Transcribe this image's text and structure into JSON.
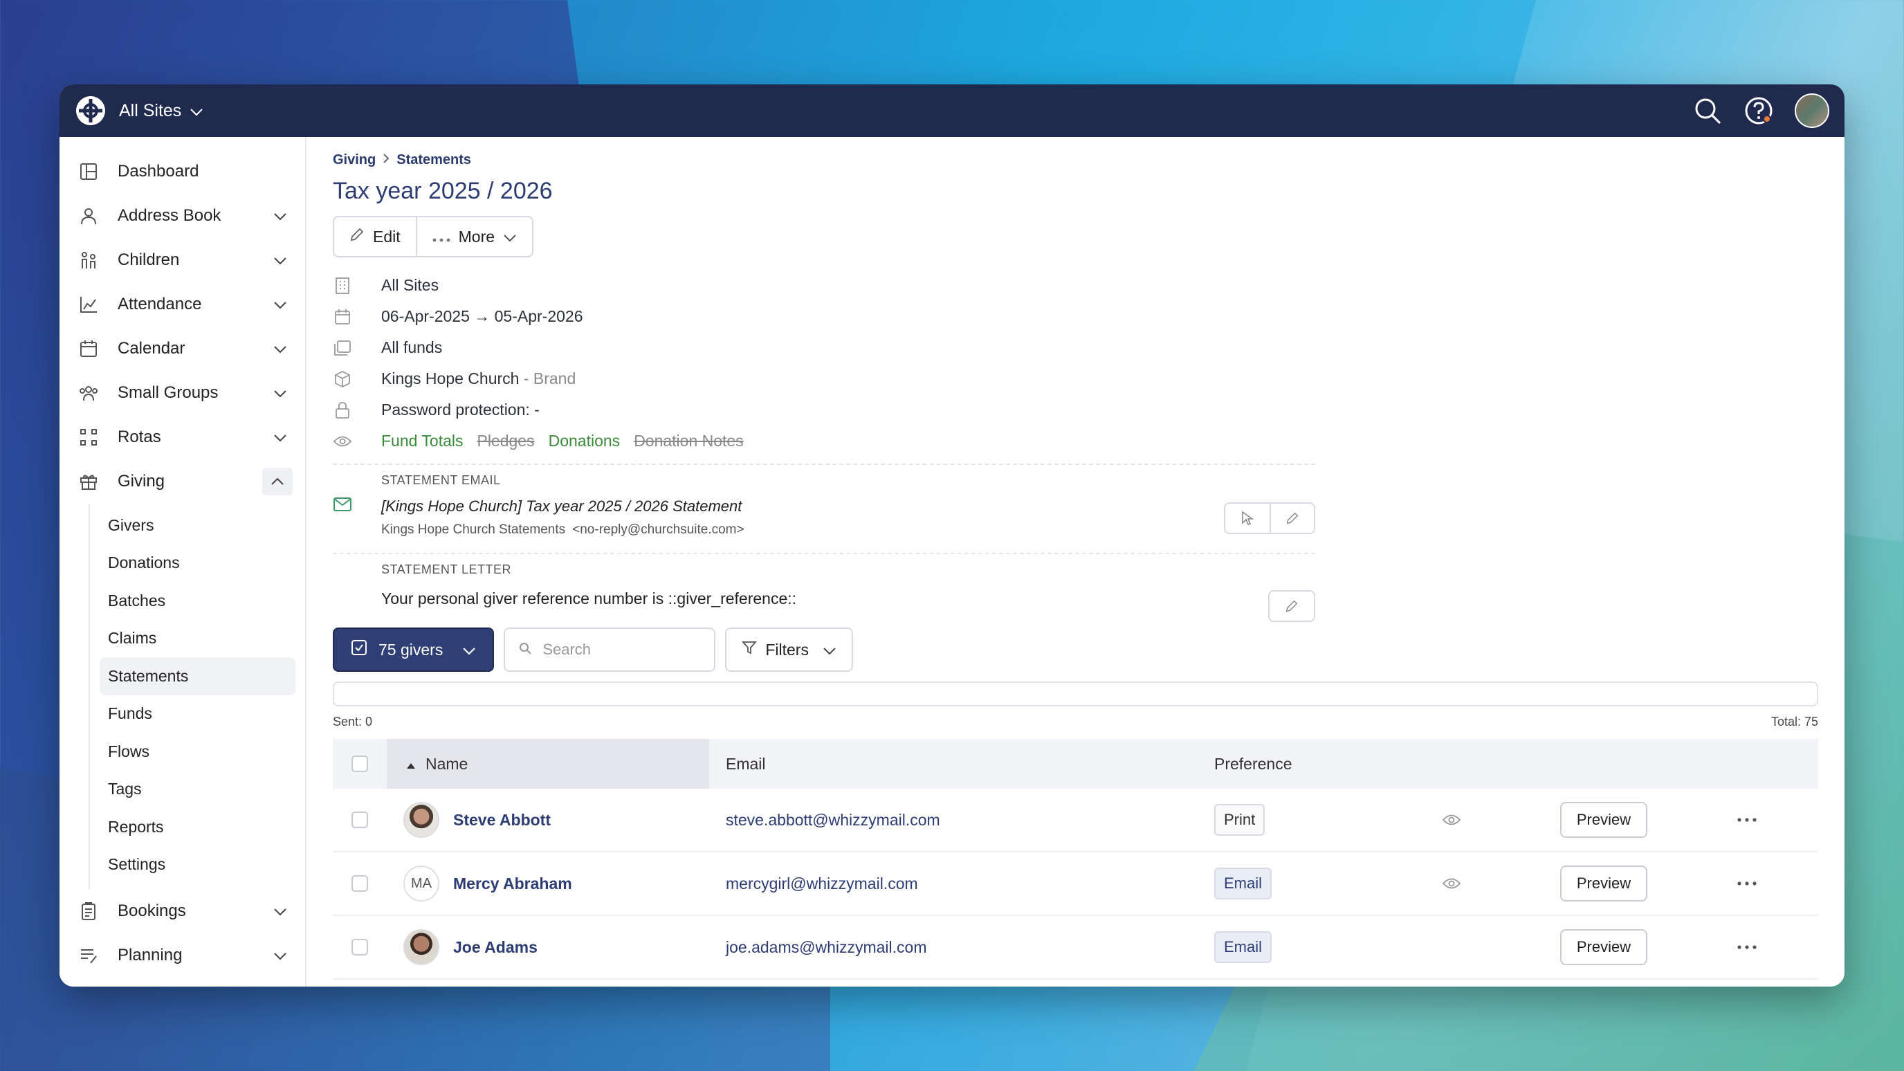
{
  "topbar": {
    "site_selector": "All Sites"
  },
  "sidebar": {
    "items": [
      {
        "label": "Dashboard",
        "icon": "dashboard-icon"
      },
      {
        "label": "Address Book",
        "icon": "person-icon"
      },
      {
        "label": "Children",
        "icon": "children-icon"
      },
      {
        "label": "Attendance",
        "icon": "chart-icon"
      },
      {
        "label": "Calendar",
        "icon": "calendar-icon"
      },
      {
        "label": "Small Groups",
        "icon": "groups-icon"
      },
      {
        "label": "Rotas",
        "icon": "rotas-icon"
      },
      {
        "label": "Giving",
        "icon": "gift-icon"
      },
      {
        "label": "Bookings",
        "icon": "clipboard-icon"
      },
      {
        "label": "Planning",
        "icon": "planning-icon"
      }
    ],
    "giving_sub": [
      "Givers",
      "Donations",
      "Batches",
      "Claims",
      "Statements",
      "Funds",
      "Flows",
      "Tags",
      "Reports",
      "Settings"
    ]
  },
  "breadcrumb": {
    "parent": "Giving",
    "current": "Statements"
  },
  "page": {
    "title": "Tax year 2025 / 2026",
    "edit_label": "Edit",
    "more_label": "More"
  },
  "meta": {
    "site": "All Sites",
    "date_range": "06-Apr-2025 → 05-Apr-2026",
    "funds": "All funds",
    "brand_name": "Kings Hope Church",
    "brand_suffix": "- Brand",
    "password": "Password protection: -",
    "vis_fund_totals": "Fund Totals",
    "vis_pledges": "Pledges",
    "vis_donations": "Donations",
    "vis_donation_notes": "Donation Notes"
  },
  "statement_email": {
    "label": "STATEMENT EMAIL",
    "subject": "[Kings Hope Church] Tax year 2025 / 2026 Statement",
    "from_name": "Kings Hope Church Statements",
    "from_address": "<no-reply@churchsuite.com>"
  },
  "statement_letter": {
    "label": "STATEMENT LETTER",
    "text": "Your personal giver reference number is ::giver_reference::"
  },
  "toolbar": {
    "givers_label": "75 givers",
    "search_placeholder": "Search",
    "filters_label": "Filters"
  },
  "counts": {
    "sent": "Sent: 0",
    "total": "Total: 75"
  },
  "table": {
    "columns": [
      "Name",
      "Email",
      "Preference"
    ],
    "preview_label": "Preview",
    "rows": [
      {
        "name": "Steve Abbott",
        "email": "steve.abbott@whizzymail.com",
        "preference": "Print",
        "initials": ""
      },
      {
        "name": "Mercy Abraham",
        "email": "mercygirl@whizzymail.com",
        "preference": "Email",
        "initials": "MA"
      },
      {
        "name": "Joe Adams",
        "email": "joe.adams@whizzymail.com",
        "preference": "Email",
        "initials": ""
      }
    ]
  },
  "colors": {
    "topbar": "#1f2a4e",
    "primary": "#2f3e74",
    "link": "#2d3d73",
    "green": "#3a8a3a"
  }
}
